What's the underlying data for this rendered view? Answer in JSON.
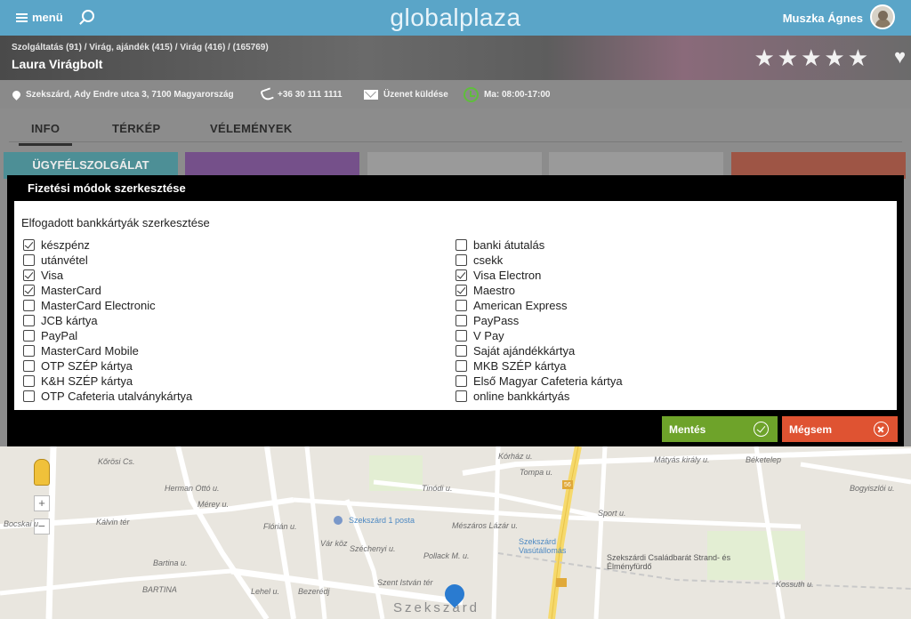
{
  "header": {
    "menu_label": "menü",
    "brand": "globalplaza",
    "user_name": "Muszka Ágnes"
  },
  "banner": {
    "breadcrumb": "Szolgáltatás (91)  /  Virág, ajándék (415)  /  Virág (416)  /  (165769)",
    "shop_name": "Laura Virágbolt",
    "rating_stars": 5
  },
  "info": {
    "address": "Szekszárd, Ady Endre utca 3, 7100 Magyarország",
    "phone": "+36 30 111 1111",
    "message": "Üzenet küldése",
    "hours": "Ma: 08:00-17:00"
  },
  "tabs": [
    {
      "label": "INFO"
    },
    {
      "label": "TÉRKÉP"
    },
    {
      "label": "VÉLEMÉNYEK"
    }
  ],
  "tiles": {
    "customer_service": "ÜGYFÉLSZOLGÁLAT"
  },
  "colors": {
    "header": "#5aa5c8",
    "tile_teal": "#4d8f96",
    "tile_purple": "#75508a",
    "tile_grey": "#9a9a9a",
    "tile_red": "#9e5545",
    "save": "#6ea32a",
    "cancel": "#df5332"
  },
  "modal": {
    "title": "Fizetési módok szerkesztése",
    "section_label": "Elfogadott bankkártyák szerkesztése",
    "left_options": [
      {
        "label": "készpénz",
        "checked": true
      },
      {
        "label": "utánvétel",
        "checked": false
      },
      {
        "label": "Visa",
        "checked": true
      },
      {
        "label": "MasterCard",
        "checked": true
      },
      {
        "label": "MasterCard Electronic",
        "checked": false
      },
      {
        "label": "JCB kártya",
        "checked": false
      },
      {
        "label": "PayPal",
        "checked": false
      },
      {
        "label": "MasterCard Mobile",
        "checked": false
      },
      {
        "label": "OTP SZÉP kártya",
        "checked": false
      },
      {
        "label": "K&H SZÉP kártya",
        "checked": false
      },
      {
        "label": "OTP Cafeteria utalványkártya",
        "checked": false
      }
    ],
    "right_options": [
      {
        "label": "banki átutalás",
        "checked": false
      },
      {
        "label": "csekk",
        "checked": false
      },
      {
        "label": "Visa Electron",
        "checked": true
      },
      {
        "label": "Maestro",
        "checked": true
      },
      {
        "label": "American Express",
        "checked": false
      },
      {
        "label": "PayPass",
        "checked": false
      },
      {
        "label": "V Pay",
        "checked": false
      },
      {
        "label": "Saját ajándékkártya",
        "checked": false
      },
      {
        "label": "MKB SZÉP kártya",
        "checked": false
      },
      {
        "label": "Első Magyar Cafeteria kártya",
        "checked": false
      },
      {
        "label": "online bankkártyás",
        "checked": false
      }
    ],
    "save_label": "Mentés",
    "cancel_label": "Mégsem"
  },
  "map": {
    "labels": [
      "Kőrösi Cs.",
      "Herman Ottó u.",
      "Mérey u.",
      "Kálvin tér",
      "Bocskai u.",
      "Bartina u.",
      "BARTINA",
      "Flórián u.",
      "Tinódi u.",
      "Szekszárd 1 posta",
      "Vár köz",
      "Széchenyi u.",
      "Mészáros Lázár u.",
      "Szekszárd Vasútállomás",
      "Szent István tér",
      "Bezerédj",
      "Lehel u.",
      "Mátyás király u.",
      "Szekszárdi Családbarát Strand- és Élményfürdő",
      "Béketelep",
      "Bogyiszlói u.",
      "Kórház u.",
      "Sport u.",
      "Tompa u.",
      "Pollack M. u.",
      "Szekszárd",
      "Kossuth u.",
      "56"
    ]
  }
}
